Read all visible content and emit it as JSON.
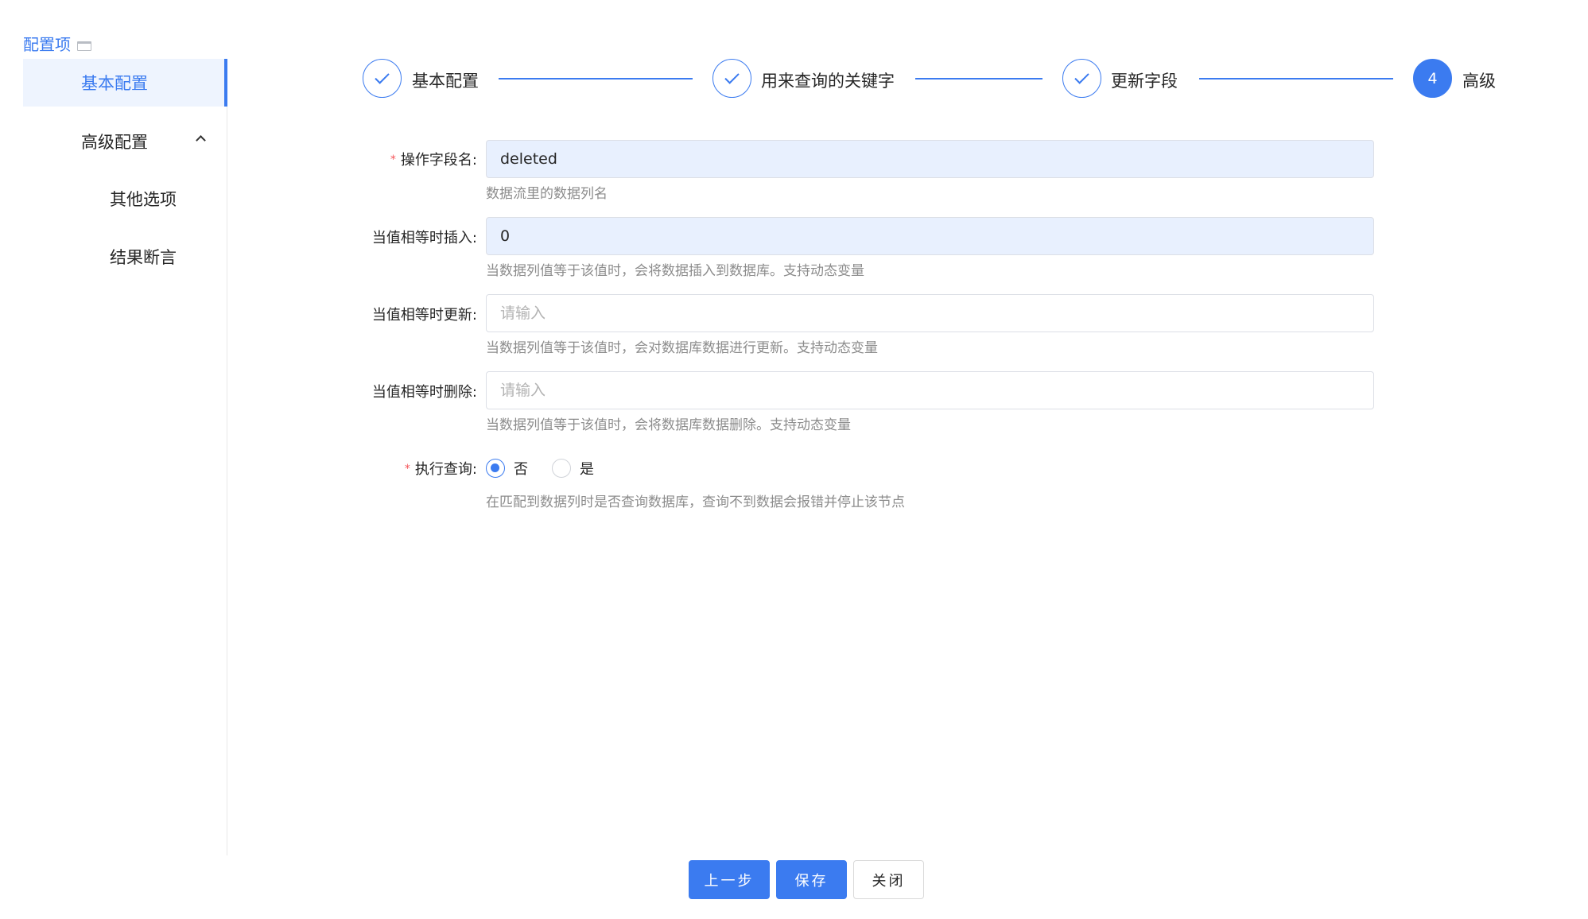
{
  "sidebar": {
    "title": "配置项",
    "items": [
      {
        "label": "基本配置"
      },
      {
        "label": "高级配置"
      },
      {
        "label": "其他选项"
      },
      {
        "label": "结果断言"
      }
    ]
  },
  "steps": [
    {
      "label": "基本配置",
      "status": "done"
    },
    {
      "label": "用来查询的关键字",
      "status": "done"
    },
    {
      "label": "更新字段",
      "status": "done"
    },
    {
      "label": "高级",
      "status": "current",
      "number": "4"
    }
  ],
  "form": {
    "field_name": {
      "label": "操作字段名:",
      "value": "deleted",
      "help": "数据流里的数据列名"
    },
    "insert_when_equal": {
      "label": "当值相等时插入:",
      "value": "0",
      "help": "当数据列值等于该值时，会将数据插入到数据库。支持动态变量"
    },
    "update_when_equal": {
      "label": "当值相等时更新:",
      "placeholder": "请输入",
      "help": "当数据列值等于该值时，会对数据库数据进行更新。支持动态变量"
    },
    "delete_when_equal": {
      "label": "当值相等时删除:",
      "placeholder": "请输入",
      "help": "当数据列值等于该值时，会将数据库数据删除。支持动态变量"
    },
    "execute_query": {
      "label": "执行查询:",
      "options": [
        {
          "label": "否",
          "checked": true
        },
        {
          "label": "是",
          "checked": false
        }
      ],
      "help": "在匹配到数据列时是否查询数据库，查询不到数据会报错并停止该节点"
    }
  },
  "footer": {
    "prev_label": "上一步",
    "save_label": "保存",
    "close_label": "关闭"
  },
  "colors": {
    "accent": "#3b7bf0",
    "required": "#f5555a",
    "filled_input_bg": "#e8f0fe"
  }
}
